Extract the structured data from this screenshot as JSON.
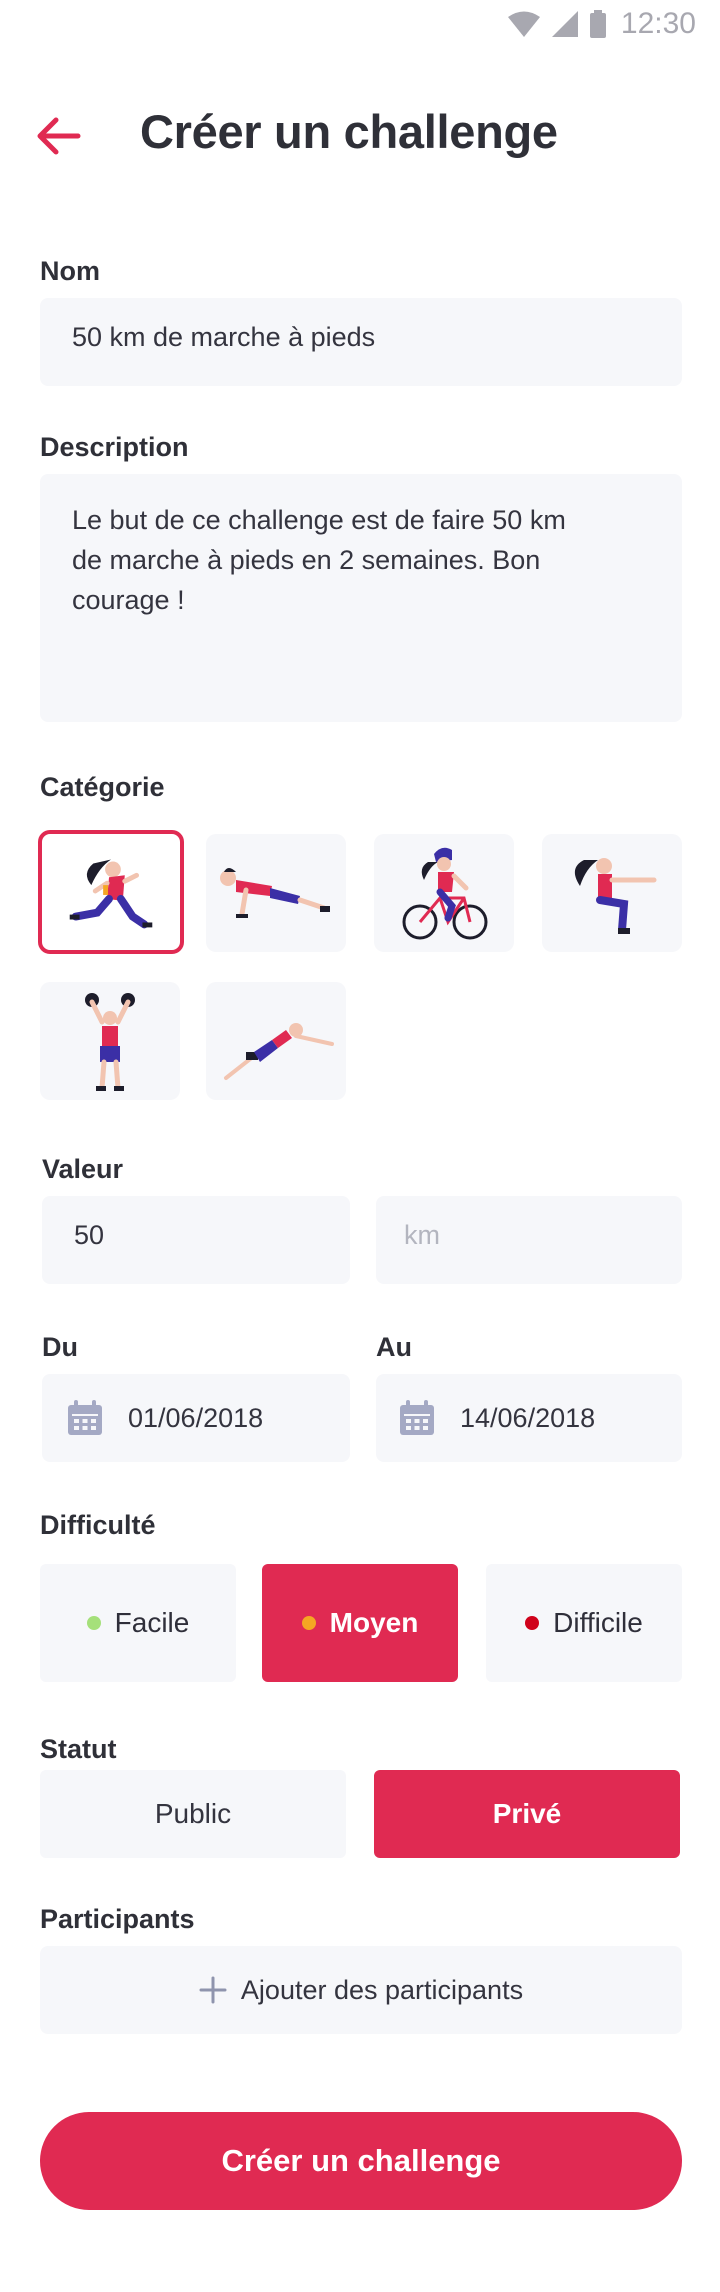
{
  "status_bar": {
    "time": "12:30"
  },
  "header": {
    "title": "Créer un challenge"
  },
  "form": {
    "name": {
      "label": "Nom",
      "value": "50 km de marche à pieds"
    },
    "description": {
      "label": "Description",
      "value": "Le but de ce challenge est de faire 50 km de marche à pieds en 2 semaines. Bon courage !"
    },
    "category": {
      "label": "Catégorie",
      "items": [
        {
          "icon": "running-woman-illustration",
          "selected": true
        },
        {
          "icon": "pushup-man-illustration",
          "selected": false
        },
        {
          "icon": "cycling-woman-illustration",
          "selected": false
        },
        {
          "icon": "squat-woman-illustration",
          "selected": false
        },
        {
          "icon": "weightlifting-man-illustration",
          "selected": false
        },
        {
          "icon": "plank-stretch-illustration",
          "selected": false
        }
      ]
    },
    "value": {
      "label": "Valeur",
      "value": "50",
      "unit_placeholder": "km"
    },
    "dates": {
      "from_label": "Du",
      "from_value": "01/06/2018",
      "to_label": "Au",
      "to_value": "14/06/2018"
    },
    "difficulty": {
      "label": "Difficulté",
      "options": [
        {
          "label": "Facile",
          "dot_color": "#a5e07a"
        },
        {
          "label": "Moyen",
          "dot_color": "#f5a623"
        },
        {
          "label": "Difficile",
          "dot_color": "#d0021b"
        }
      ],
      "selected": "Moyen"
    },
    "visibility": {
      "label": "Statut",
      "options": [
        "Public",
        "Privé"
      ],
      "selected": "Privé"
    },
    "participants": {
      "label": "Participants",
      "add_label": "Ajouter des participants"
    }
  },
  "submit": {
    "label": "Créer un challenge"
  },
  "colors": {
    "accent": "#e02a52",
    "field_bg": "#f6f7fa",
    "text": "#2f3038",
    "icon_muted": "#a4a9c4"
  }
}
